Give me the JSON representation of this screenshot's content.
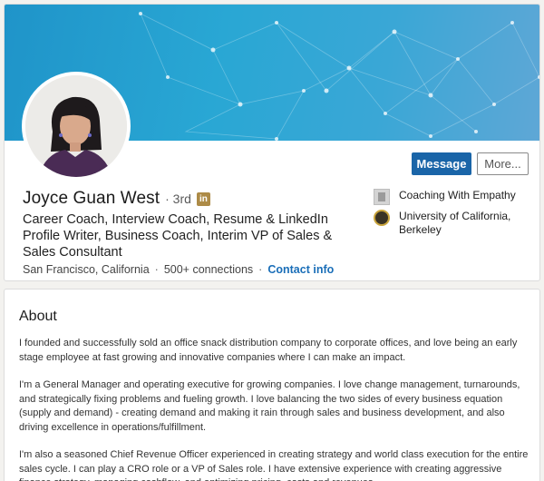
{
  "profile": {
    "name": "Joyce Guan West",
    "degree": "· 3rd",
    "linkedin_badge": "in",
    "headline": "Career Coach, Interview Coach, Resume & LinkedIn Profile Writer, Business Coach, Interim VP of Sales & Sales Consultant",
    "location": "San Francisco, California",
    "connections": "500+ connections",
    "contact_link": "Contact info",
    "separator": "·",
    "icons": {
      "avatar": "profile-photo",
      "badge": "linkedin-premium-icon"
    }
  },
  "actions": {
    "message_label": "Message",
    "more_label": "More..."
  },
  "side": {
    "company": "Coaching With Empathy",
    "school": "University of California, Berkeley"
  },
  "about": {
    "title": "About",
    "paragraphs": [
      "I founded and successfully sold an office snack distribution company to corporate offices, and love being an early stage employee at fast growing and innovative companies where I can make an impact.",
      "I'm a General Manager and operating executive for growing companies. I love change management, turnarounds, and strategically fixing problems and fueling growth. I love balancing the two sides of every business equation (supply and demand) - creating demand and making it rain through sales and business development, and also driving excellence in operations/fulfillment.",
      "I'm also a seasoned Chief Revenue Officer experienced in creating strategy and world class execution for the entire sales cycle. I can play a CRO role or a VP of Sales role. I have extensive experience with creating aggressive finance strategy, managing cashflow, and optimizing pricing, costs and revenues."
    ]
  },
  "colors": {
    "banner": "#29a7d4",
    "primary_button": "#1a65a8",
    "link": "#1a6eb8",
    "premium_badge": "#ad8b47"
  }
}
